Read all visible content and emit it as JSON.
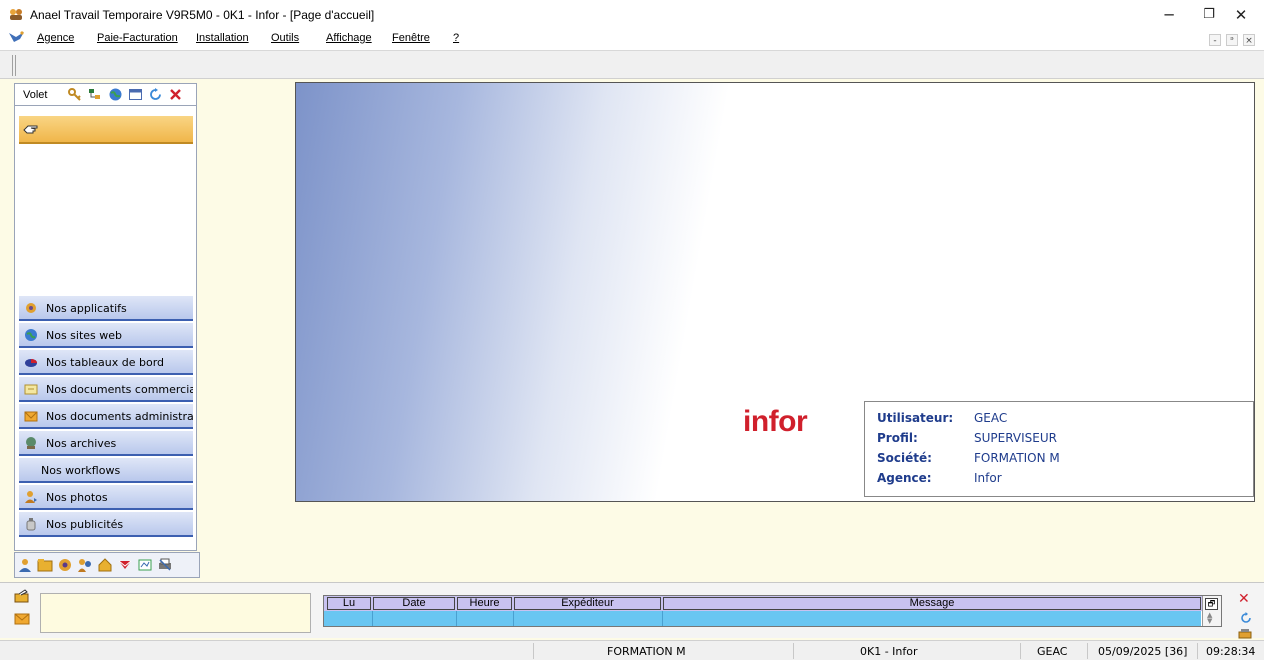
{
  "window": {
    "title": "Anael Travail Temporaire V9R5M0 - 0K1 - Infor - [Page d'accueil]",
    "controls": {
      "minimize": "─",
      "restore": "❐",
      "close": "✕"
    }
  },
  "menubar": {
    "items": [
      {
        "label": "Agence"
      },
      {
        "label": "Paie-Facturation"
      },
      {
        "label": "Installation"
      },
      {
        "label": "Outils"
      },
      {
        "label": "Affichage"
      },
      {
        "label": "Fenêtre"
      },
      {
        "label": "?"
      }
    ],
    "mdi_controls": {
      "minimize": "-",
      "restore": "ᵊ",
      "close": "×"
    }
  },
  "volet": {
    "label": "Volet",
    "tools": [
      "key-icon",
      "tree-icon",
      "globe-icon",
      "window-icon",
      "refresh-icon",
      "close-icon"
    ],
    "active_icon": "hand-pointer-icon",
    "items": [
      {
        "label": "Nos applicatifs",
        "icon": "gear-icon"
      },
      {
        "label": "Nos sites web",
        "icon": "globe-icon"
      },
      {
        "label": "Nos tableaux de bord",
        "icon": "pie-chart-icon"
      },
      {
        "label": "Nos documents commercia",
        "icon": "document-icon"
      },
      {
        "label": "Nos documents administra",
        "icon": "envelope-icon"
      },
      {
        "label": "Nos archives",
        "icon": "archive-icon"
      },
      {
        "label": "Nos workflows",
        "icon": ""
      },
      {
        "label": "Nos photos",
        "icon": "person-icon"
      },
      {
        "label": "Nos publicités",
        "icon": "bottle-icon"
      }
    ],
    "bottom_tabs": [
      "person-icon",
      "folder-icon",
      "gear-icon",
      "people-icon",
      "house-icon",
      "mail-icon",
      "chart-icon",
      "printer-icon"
    ]
  },
  "main": {
    "logo_text": "infor",
    "info": [
      {
        "key": "Utilisateur:",
        "value": "GEAC"
      },
      {
        "key": "Profil:",
        "value": "SUPERVISEUR"
      },
      {
        "key": "Société:",
        "value": "FORMATION M"
      },
      {
        "key": "Agence:",
        "value": "Infor"
      }
    ]
  },
  "messages": {
    "columns": [
      "Lu",
      "Date",
      "Heure",
      "Expéditeur",
      "Message"
    ],
    "scroll_button": "🗗",
    "side_close": "✕"
  },
  "statusbar": {
    "company": "FORMATION M",
    "environment": "0K1 - Infor",
    "user": "GEAC",
    "date": "05/09/2025 [36]",
    "time": "09:28:34"
  },
  "colors": {
    "accent_blue": "#3c5fb0",
    "active_orange": "#f0b64a",
    "infor_red": "#d0202c",
    "message_row": "#69c6f2"
  }
}
